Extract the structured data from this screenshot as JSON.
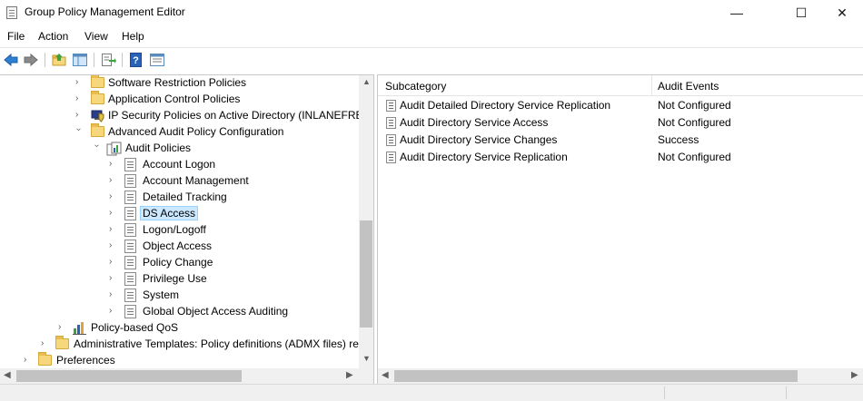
{
  "window": {
    "title": "Group Policy Management Editor",
    "controls": [
      "minimize",
      "maximize",
      "close"
    ]
  },
  "menu": [
    "File",
    "Action",
    "View",
    "Help"
  ],
  "toolbar": {
    "icons": [
      "back-icon",
      "forward-icon",
      "up-folder-icon",
      "show-hide-tree-icon",
      "export-list-icon",
      "help-icon",
      "properties-icon"
    ]
  },
  "tree": {
    "nodes": [
      {
        "label": "Software Restriction Policies",
        "icon": "folder-icon",
        "expanded": false
      },
      {
        "label": "Application Control Policies",
        "icon": "folder-icon",
        "expanded": false
      },
      {
        "label": "IP Security Policies on Active Directory (INLANEFREI",
        "icon": "shield-computer-icon",
        "expanded": false
      },
      {
        "label": "Advanced Audit Policy Configuration",
        "icon": "folder-icon",
        "expanded": true
      },
      {
        "label": "Audit Policies",
        "icon": "audit-policies-icon",
        "expanded": true
      },
      {
        "label": "Account Logon",
        "icon": "policy-doc-icon",
        "expanded": false
      },
      {
        "label": "Account Management",
        "icon": "policy-doc-icon",
        "expanded": false
      },
      {
        "label": "Detailed Tracking",
        "icon": "policy-doc-icon",
        "expanded": false
      },
      {
        "label": "DS Access",
        "icon": "policy-doc-icon",
        "expanded": false,
        "selected": true
      },
      {
        "label": "Logon/Logoff",
        "icon": "policy-doc-icon",
        "expanded": false
      },
      {
        "label": "Object Access",
        "icon": "policy-doc-icon",
        "expanded": false
      },
      {
        "label": "Policy Change",
        "icon": "policy-doc-icon",
        "expanded": false
      },
      {
        "label": "Privilege Use",
        "icon": "policy-doc-icon",
        "expanded": false
      },
      {
        "label": "System",
        "icon": "policy-doc-icon",
        "expanded": false
      },
      {
        "label": "Global Object Access Auditing",
        "icon": "policy-doc-icon",
        "expanded": false
      },
      {
        "label": "Policy-based QoS",
        "icon": "bar-chart-icon",
        "expanded": false
      },
      {
        "label": "Administrative Templates: Policy definitions (ADMX files) re",
        "icon": "folder-icon",
        "expanded": false
      },
      {
        "label": "Preferences",
        "icon": "folder-icon",
        "expanded": false
      }
    ]
  },
  "list": {
    "columns": [
      "Subcategory",
      "Audit Events"
    ],
    "rows": [
      {
        "subcategory": "Audit Detailed Directory Service Replication",
        "events": "Not Configured"
      },
      {
        "subcategory": "Audit Directory Service Access",
        "events": "Not Configured"
      },
      {
        "subcategory": "Audit Directory Service Changes",
        "events": "Success"
      },
      {
        "subcategory": "Audit Directory Service Replication",
        "events": "Not Configured"
      }
    ]
  },
  "colors": {
    "selection_bg": "#cce8ff",
    "selection_border": "#99d1ff",
    "scrollbar_track": "#f0f0f0",
    "scrollbar_thumb": "#c2c2c2"
  }
}
